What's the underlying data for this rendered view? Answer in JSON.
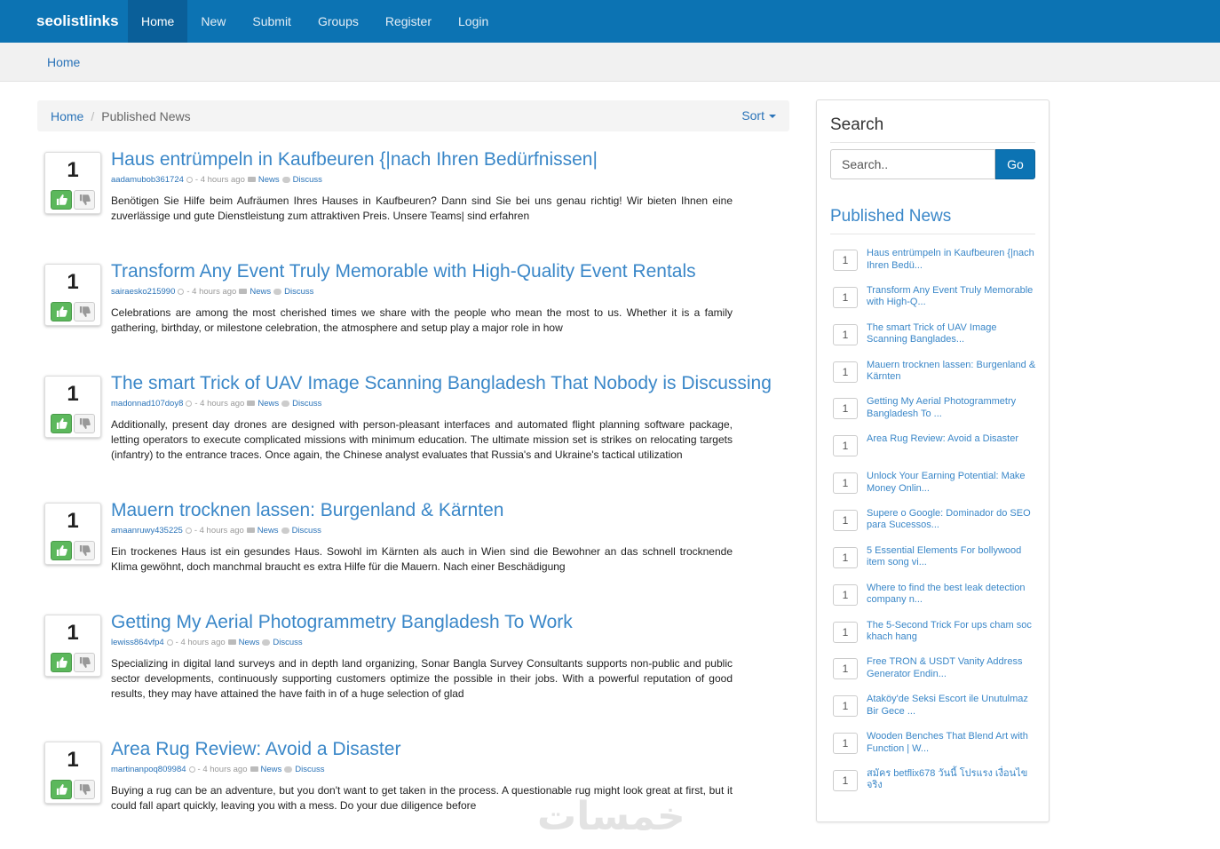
{
  "navbar": {
    "brand": "seolistlinks",
    "links": [
      "Home",
      "New",
      "Submit",
      "Groups",
      "Register",
      "Login"
    ],
    "active": "Home"
  },
  "subbar": {
    "crumb": "Home"
  },
  "breadcrumb": {
    "home": "Home",
    "separator": "/",
    "current": "Published News",
    "sort_label": "Sort"
  },
  "stories": [
    {
      "votes": "1",
      "title": "Haus entrümpeln in Kaufbeuren {|nach Ihren Bedürfnissen|",
      "user": "aadamubob361724",
      "time": "- 4 hours ago",
      "category": "News",
      "discuss": "Discuss",
      "description": "Benötigen Sie Hilfe beim Aufräumen Ihres Hauses in Kaufbeuren? Dann sind Sie bei uns genau richtig! Wir bieten Ihnen eine zuverlässige und gute Dienstleistung zum attraktiven Preis. Unsere Teams| sind erfahren"
    },
    {
      "votes": "1",
      "title": "Transform Any Event Truly Memorable with High-Quality Event Rentals",
      "user": "sairaesko215990",
      "time": "- 4 hours ago",
      "category": "News",
      "discuss": "Discuss",
      "description": "Celebrations are among the most cherished times we share with the people who mean the most to us. Whether it is a family gathering, birthday, or milestone celebration, the atmosphere and setup play a major role in how"
    },
    {
      "votes": "1",
      "title": "The smart Trick of UAV Image Scanning Bangladesh That Nobody is Discussing",
      "user": "madonnad107doy8",
      "time": "- 4 hours ago",
      "category": "News",
      "discuss": "Discuss",
      "description": "Additionally, present day drones are designed with person-pleasant interfaces and automated flight planning software package, letting operators to execute complicated missions with minimum education. The ultimate mission set is strikes on relocating targets (infantry) to the entrance traces. Once again, the Chinese analyst evaluates that Russia's and Ukraine's tactical utilization"
    },
    {
      "votes": "1",
      "title": "Mauern trocknen lassen: Burgenland & Kärnten",
      "user": "amaanruwy435225",
      "time": "- 4 hours ago",
      "category": "News",
      "discuss": "Discuss",
      "description": "Ein trockenes Haus ist ein gesundes Haus. Sowohl im Kärnten als auch in Wien sind die Bewohner an das schnell trocknende Klima gewöhnt, doch manchmal braucht es extra Hilfe für die Mauern. Nach einer Beschädigung"
    },
    {
      "votes": "1",
      "title": "Getting My Aerial Photogrammetry Bangladesh To Work",
      "user": "lewiss864vfp4",
      "time": "- 4 hours ago",
      "category": "News",
      "discuss": "Discuss",
      "description": "Specializing in digital land surveys and in depth land organizing, Sonar Bangla Survey Consultants supports non-public and public sector developments, continuously supporting customers optimize the possible in their jobs. With a powerful reputation of good results, they may have attained the have faith in of a huge selection of glad"
    },
    {
      "votes": "1",
      "title": "Area Rug Review: Avoid a Disaster",
      "user": "martinanpoq809984",
      "time": "- 4 hours ago",
      "category": "News",
      "discuss": "Discuss",
      "description": "Buying a rug can be an adventure, but you don't want to get taken in the process. A questionable rug might look great at first, but it could fall apart quickly, leaving you with a mess. Do your due diligence before"
    }
  ],
  "sidebar": {
    "search_title": "Search",
    "search_placeholder": "Search..",
    "go_label": "Go",
    "published_title": "Published News",
    "items": [
      {
        "votes": "1",
        "title": "Haus entrümpeln in Kaufbeuren {|nach Ihren Bedü..."
      },
      {
        "votes": "1",
        "title": "Transform Any Event Truly Memorable with High-Q..."
      },
      {
        "votes": "1",
        "title": "The smart Trick of UAV Image Scanning Banglades..."
      },
      {
        "votes": "1",
        "title": "Mauern trocknen lassen: Burgenland & Kärnten"
      },
      {
        "votes": "1",
        "title": "Getting My Aerial Photogrammetry Bangladesh To ..."
      },
      {
        "votes": "1",
        "title": "Area Rug Review: Avoid a Disaster"
      },
      {
        "votes": "1",
        "title": "Unlock Your Earning Potential: Make Money Onlin..."
      },
      {
        "votes": "1",
        "title": "Supere o Google: Dominador do SEO para Sucessos..."
      },
      {
        "votes": "1",
        "title": "5 Essential Elements For bollywood item song vi..."
      },
      {
        "votes": "1",
        "title": "Where to find the best leak detection company n..."
      },
      {
        "votes": "1",
        "title": "The 5-Second Trick For ups cham soc khach hang"
      },
      {
        "votes": "1",
        "title": "Free TRON & USDT Vanity Address Generator Endin..."
      },
      {
        "votes": "1",
        "title": "Ataköy'de Seksi Escort ile Unutulmaz Bir Gece ..."
      },
      {
        "votes": "1",
        "title": "Wooden Benches That Blend Art with Function | W..."
      },
      {
        "votes": "1",
        "title": "สมัคร betflix678 วันนี้ โปรแรง เงื่อนไขจริง"
      }
    ]
  },
  "watermark": "خمسات",
  "colors": {
    "nav": "#0c73b3",
    "link": "#2a73b8",
    "title": "#3a87c8",
    "upvote": "#5cb85c"
  }
}
